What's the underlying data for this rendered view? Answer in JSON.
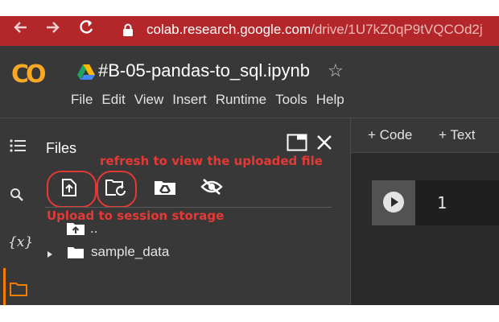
{
  "browser": {
    "url_host": "colab.research.google.com",
    "url_path": "/drive/1U7kZ0qP9tVQCOd2j",
    "back_icon": "arrow-left",
    "forward_icon": "arrow-right",
    "reload_icon": "reload",
    "lock_icon": "lock"
  },
  "app": {
    "logo_text": "CO",
    "notebook_title": "#B-05-pandas-to_sql.ipynb",
    "menu": [
      "File",
      "Edit",
      "View",
      "Insert",
      "Runtime",
      "Tools",
      "Help"
    ]
  },
  "sidebar": {
    "files_title": "Files",
    "variables_icon_text": "{x}"
  },
  "file_tree": {
    "parent_label": "..",
    "folder_label": "sample_data"
  },
  "annotations": {
    "refresh_note": "refresh to view the uploaded file",
    "upload_note": "Upload to session storage",
    "color": "#e53935"
  },
  "toolbar": {
    "code_label": "+ Code",
    "text_label": "+ Text"
  },
  "cell": {
    "number": "1"
  },
  "colors": {
    "browser_bar": "#b3272a",
    "app_bg": "#383838",
    "logo": "#f9a825",
    "active_rail": "#f57c00"
  }
}
